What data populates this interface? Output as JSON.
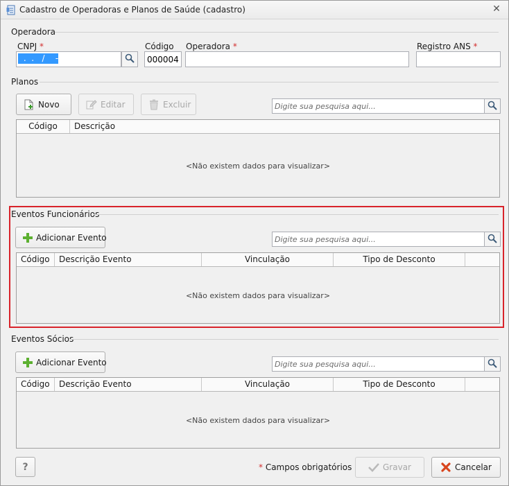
{
  "window": {
    "title": "Cadastro de Operadoras e Planos de Saúde (cadastro)",
    "close_symbol": "✕"
  },
  "operadora_group": {
    "title": "Operadora",
    "cnpj_label": "CNPJ",
    "cnpj_value": " .  .   /    -  ",
    "codigo_label": "Código",
    "codigo_value": "000004",
    "operadora_label": "Operadora",
    "operadora_value": "",
    "registro_label": "Registro ANS",
    "registro_value": "",
    "required_mark": "*"
  },
  "planos_group": {
    "title": "Planos",
    "novo_label": "Novo",
    "editar_label": "Editar",
    "excluir_label": "Excluir",
    "search_placeholder": "Digite sua pesquisa aqui...",
    "columns": [
      "Código",
      "Descrição"
    ],
    "empty_text": "<Não existem dados para visualizar>"
  },
  "eventos_funcionarios_group": {
    "title": "Eventos Funcionários",
    "add_label": "Adicionar Evento",
    "search_placeholder": "Digite sua pesquisa aqui...",
    "columns": [
      "Código",
      "Descrição Evento",
      "Vinculação",
      "Tipo de Desconto",
      ""
    ],
    "empty_text": "<Não existem dados para visualizar>",
    "highlight_color": "#d8232a"
  },
  "eventos_socios_group": {
    "title": "Eventos Sócios",
    "add_label": "Adicionar Evento",
    "search_placeholder": "Digite sua pesquisa aqui...",
    "columns": [
      "Código",
      "Descrição Evento",
      "Vinculação",
      "Tipo de Desconto",
      ""
    ],
    "empty_text": "<Não existem dados para visualizar>"
  },
  "footer": {
    "help_label": "?",
    "required_note_mark": "*",
    "required_note": "Campos obrigatórios",
    "gravar_label": "Gravar",
    "cancelar_label": "Cancelar"
  },
  "icons": {
    "title": "form-document-icon",
    "search": "magnifier-icon",
    "novo": "new-document-icon",
    "editar": "edit-pencil-icon",
    "excluir": "trash-icon",
    "adicionar": "green-plus-icon",
    "gravar": "check-icon",
    "cancelar": "red-x-icon"
  }
}
